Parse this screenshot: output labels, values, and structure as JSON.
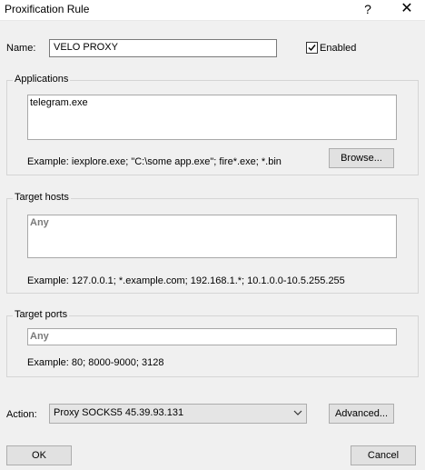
{
  "window": {
    "title": "Proxification Rule",
    "help": "?",
    "close": "✕"
  },
  "name": {
    "label": "Name:",
    "value": "VELO PROXY"
  },
  "enabled": {
    "label": "Enabled",
    "checked": true
  },
  "applications": {
    "title": "Applications",
    "value": "telegram.exe",
    "example": "Example: iexplore.exe; \"C:\\some app.exe\"; fire*.exe; *.bin",
    "browse_label": "Browse..."
  },
  "target_hosts": {
    "title": "Target hosts",
    "value": "Any",
    "example": "Example: 127.0.0.1; *.example.com; 192.168.1.*; 10.1.0.0-10.5.255.255"
  },
  "target_ports": {
    "title": "Target ports",
    "value": "Any",
    "example": "Example: 80; 8000-9000; 3128"
  },
  "action": {
    "label": "Action:",
    "selected": "Proxy SOCKS5 45.39.93.131",
    "advanced_label": "Advanced..."
  },
  "footer": {
    "ok_label": "OK",
    "cancel_label": "Cancel"
  }
}
